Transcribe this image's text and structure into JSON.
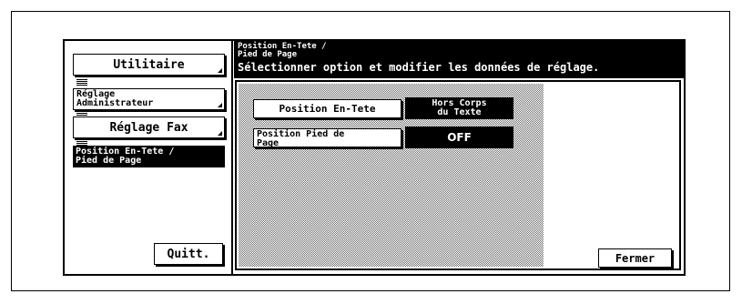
{
  "sidebar": {
    "utilitaire_label": "Utilitaire",
    "admin_label": "Réglage\nAdministrateur",
    "fax_label": "Réglage Fax",
    "active_label": "Position En-Tete /\nPied de Page",
    "quitt_label": "Quitt."
  },
  "header": {
    "title": "Position En-Tete /\nPied de Page",
    "instruction": "Sélectionner option et modifier les données de réglage."
  },
  "options": [
    {
      "label": "Position En-Tete",
      "value": "Hors Corps\ndu Texte"
    },
    {
      "label": "Position Pied de\nPage",
      "value": "OFF"
    }
  ],
  "footer": {
    "close_label": "Fermer"
  },
  "colors": {
    "foreground": "#000000",
    "background": "#ffffff"
  }
}
